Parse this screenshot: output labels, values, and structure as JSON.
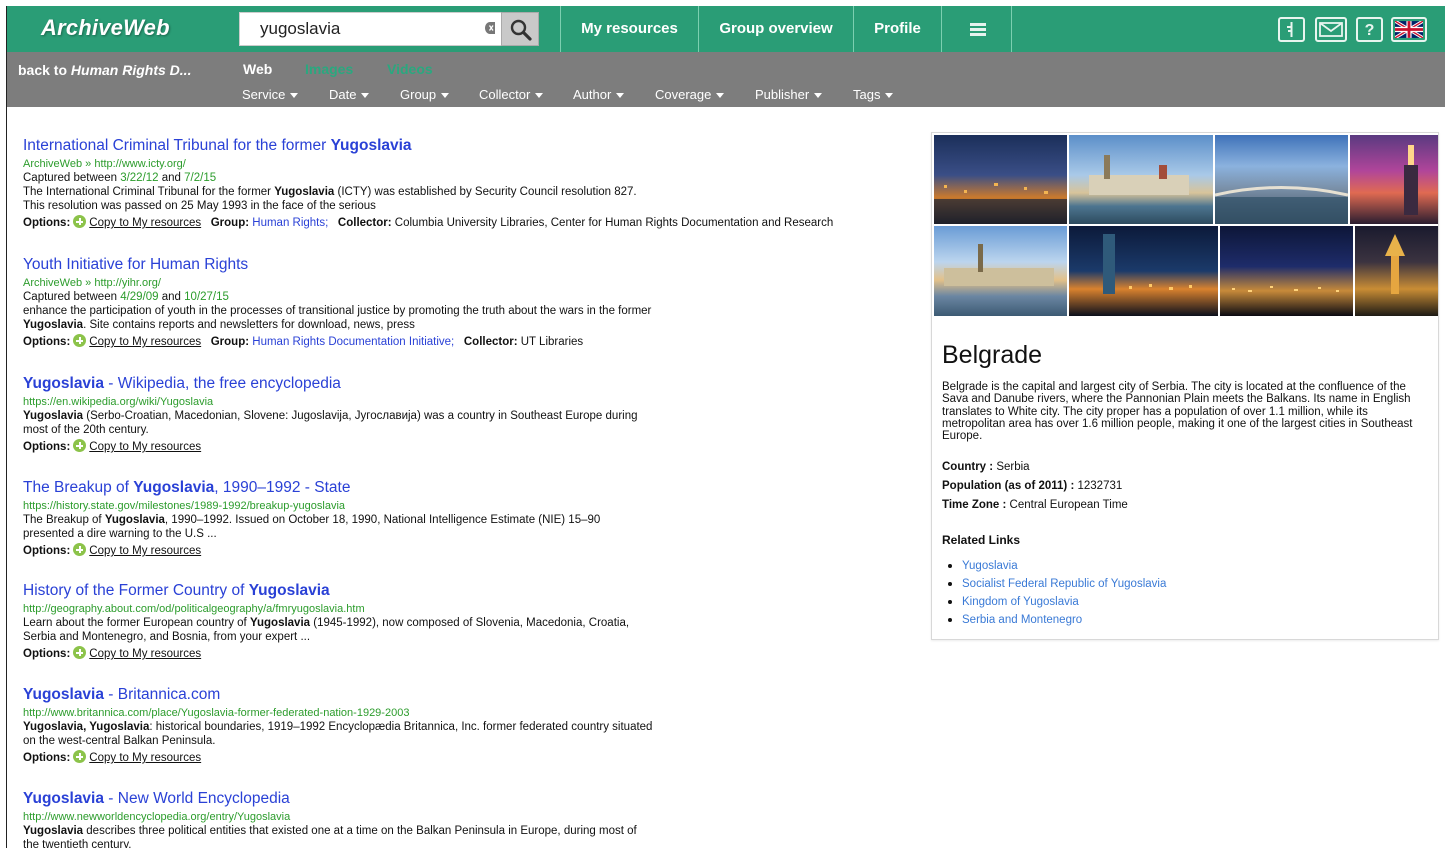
{
  "app": {
    "logo": "ArchiveWeb"
  },
  "search": {
    "query": "yugoslavia"
  },
  "nav": {
    "my_resources": "My resources",
    "group_overview": "Group overview",
    "profile": "Profile"
  },
  "icons": {
    "menu": "hamburger-menu-icon",
    "tool1": "tool-icon",
    "mail": "mail-icon",
    "help": "help-icon",
    "language": "uk-flag-icon"
  },
  "subnav": {
    "back_prefix": "back to ",
    "back_target": "Human Rights D...",
    "tabs": [
      "Web",
      "Images",
      "Videos"
    ],
    "filters": [
      "Service",
      "Date",
      "Group",
      "Collector",
      "Author",
      "Coverage",
      "Publisher",
      "Tags"
    ]
  },
  "labels": {
    "options": "Options:",
    "copy": "Copy to My resources",
    "group": "Group:",
    "collector": "Collector:",
    "captured_between": "Captured between",
    "and": "and",
    "source_prefix": "ArchiveWeb » "
  },
  "results": [
    {
      "title_pre": "International Criminal Tribunal for the former ",
      "title_bold": "Yugoslavia",
      "title_post": "",
      "url": "http://www.icty.org/",
      "captured_from": "3/22/12",
      "captured_to": "7/2/15",
      "snippet_pre": "The International Criminal Tribunal for the former ",
      "snippet_bold": "Yugoslavia",
      "snippet_post": " (ICTY) was established by Security Council resolution 827. This resolution was passed on 25 May 1993 in the face of the serious",
      "group": "Human Rights;",
      "collector": "Columbia University Libraries, Center for Human Rights Documentation and Research"
    },
    {
      "title_pre": "Youth Initiative for Human Rights",
      "title_bold": "",
      "title_post": "",
      "url": "http://yihr.org/",
      "captured_from": "4/29/09",
      "captured_to": "10/27/15",
      "snippet_pre": "enhance the participation of youth in the processes of transitional justice by promoting the truth about the wars in the former ",
      "snippet_bold": "Yugoslavia",
      "snippet_post": ". Site contains reports and newsletters for download, news, press",
      "group": "Human Rights Documentation Initiative;",
      "collector": "UT Libraries"
    },
    {
      "title_pre": "",
      "title_bold": "Yugoslavia",
      "title_post": " - Wikipedia, the free encyclopedia",
      "url": "https://en.wikipedia.org/wiki/Yugoslavia",
      "snippet_pre": "",
      "snippet_bold": "Yugoslavia",
      "snippet_post": " (Serbo-Croatian, Macedonian, Slovene: Jugoslavija, Југославија) was a country in Southeast Europe during most of the 20th century."
    },
    {
      "title_pre": "The Breakup of ",
      "title_bold": "Yugoslavia",
      "title_post": ", 1990–1992 - State",
      "url": "https://history.state.gov/milestones/1989-1992/breakup-yugoslavia",
      "snippet_pre": "The Breakup of ",
      "snippet_bold": "Yugoslavia",
      "snippet_post": ", 1990–1992. Issued on October 18, 1990, National Intelligence Estimate (NIE) 15–90 presented a dire warning to the U.S ..."
    },
    {
      "title_pre": "History of the Former Country of ",
      "title_bold": "Yugoslavia",
      "title_post": "",
      "url": "http://geography.about.com/od/politicalgeography/a/fmryugoslavia.htm",
      "snippet_pre": "Learn about the former European country of ",
      "snippet_bold": "Yugoslavia",
      "snippet_post": " (1945-1992), now composed of Slovenia, Macedonia, Croatia, Serbia and Montenegro, and Bosnia, from your expert ..."
    },
    {
      "title_pre": "",
      "title_bold": "Yugoslavia",
      "title_post": " - Britannica.com",
      "url": "http://www.britannica.com/place/Yugoslavia-former-federated-nation-1929-2003",
      "snippet_pre": "",
      "snippet_bold": "Yugoslavia, Yugoslavia",
      "snippet_post": ": historical boundaries, 1919–1992 Encyclopædia Britannica, Inc. former federated country situated on the west-central Balkan Peninsula."
    },
    {
      "title_pre": "",
      "title_bold": "Yugoslavia",
      "title_post": " - New World Encyclopedia",
      "url": "http://www.newworldencyclopedia.org/entry/Yugoslavia",
      "snippet_pre": "",
      "snippet_bold": "Yugoslavia",
      "snippet_post": " describes three political entities that existed one at a time on the Balkan Peninsula in Europe, during most of the twentieth century."
    }
  ],
  "panel": {
    "title": "Belgrade",
    "description": "Belgrade is the capital and largest city of Serbia. The city is located at the confluence of the Sava and Danube rivers, where the Pannonian Plain meets the Balkans. Its name in English translates to White city. The city proper has a population of over 1.1 million, while its metropolitan area has over 1.6 million people, making it one of the largest cities in Southeast Europe.",
    "country_label": "Country :",
    "country": "Serbia",
    "population_label": "Population (as of 2011) :",
    "population": "1232731",
    "timezone_label": "Time Zone :",
    "timezone": "Central European Time",
    "related_heading": "Related Links",
    "related_links": [
      "Yugoslavia",
      "Socialist Federal Republic of Yugoslavia",
      "Kingdom of Yugoslavia",
      "Serbia and Montenegro"
    ],
    "photos": [
      "belgrade-night-photo",
      "belgrade-riverbank-photo",
      "belgrade-bridge-photo",
      "belgrade-tower-photo",
      "belgrade-fortress-photo",
      "belgrade-skyscraper-photo",
      "belgrade-city-lights-photo",
      "belgrade-church-photo"
    ]
  }
}
